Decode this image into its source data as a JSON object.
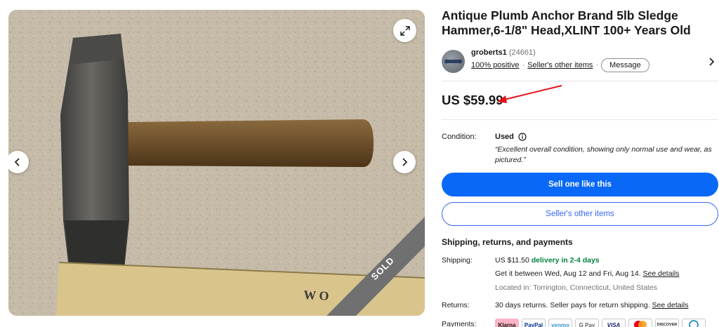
{
  "listing": {
    "title": "Antique Plumb Anchor Brand 5lb Sledge Hammer,6-1/8\" Head,XLINT 100+ Years Old",
    "sold_badge": "SOLD"
  },
  "seller": {
    "name": "groberts1",
    "feedback_count": "(24661)",
    "positive": "100% positive",
    "other_items_link": "Seller's other items",
    "separator": "·",
    "message_button": "Message"
  },
  "price": "US $59.99",
  "condition": {
    "label": "Condition:",
    "value": "Used",
    "quote": "“Excellent overall condition, showing only normal use and wear, as pictured.”"
  },
  "buttons": {
    "sell_one": "Sell one like this",
    "other_items": "Seller's other items"
  },
  "shipping": {
    "heading": "Shipping, returns, and payments",
    "shipping_label": "Shipping:",
    "cost": "US $11.50",
    "delivery": "delivery in 2-4 days",
    "eta": "Get it between Wed, Aug 12 and Fri, Aug 14.",
    "see_details": "See details",
    "location": "Located in: Torrington, Connecticut, United States",
    "returns_label": "Returns:",
    "returns_text": "30 days returns. Seller pays for return shipping.",
    "returns_link": "See details",
    "payments_label": "Payments:"
  },
  "payments": [
    "Klarna",
    "PayPal",
    "venmo",
    "G Pay",
    "VISA",
    "",
    "DISCOVER",
    ""
  ],
  "colors": {
    "primary_blue": "#0968f6",
    "link_blue": "#3665f3",
    "green": "#05823f",
    "annotation_red": "#e5131b"
  },
  "icons": [
    "expand-icon",
    "chevron-left-icon",
    "chevron-right-icon",
    "info-icon",
    "arrow-annotation"
  ]
}
